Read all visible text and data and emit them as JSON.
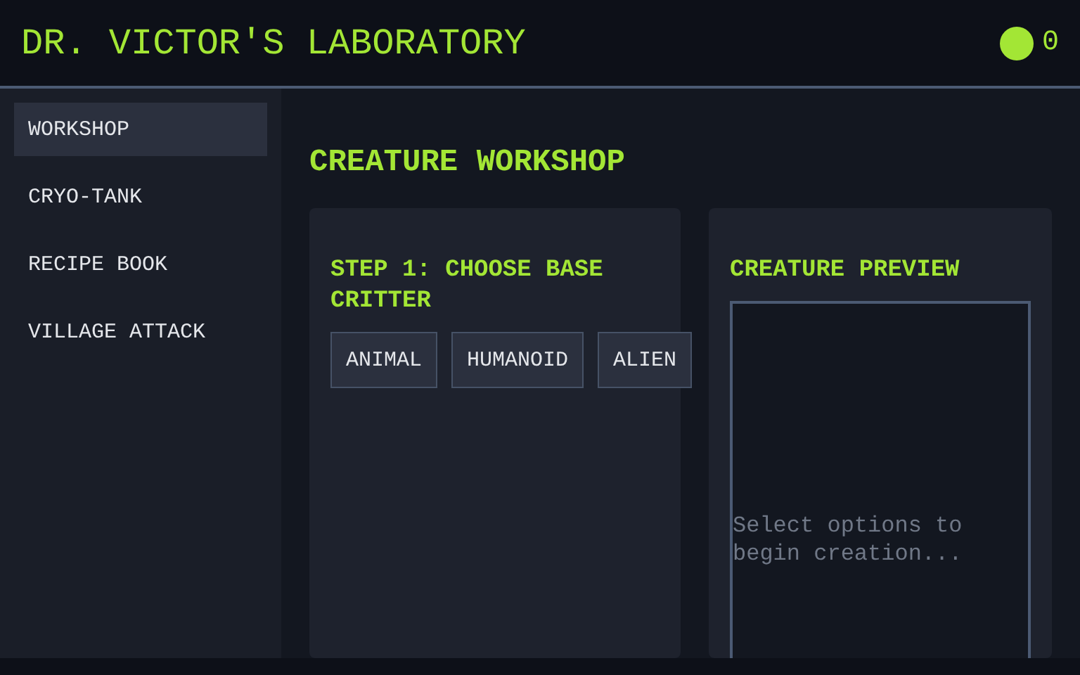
{
  "header": {
    "title": "DR. VICTOR'S LABORATORY",
    "status_count": "0"
  },
  "sidebar": {
    "items": [
      {
        "label": "WORKSHOP",
        "selected": true
      },
      {
        "label": "CRYO-TANK",
        "selected": false
      },
      {
        "label": "RECIPE BOOK",
        "selected": false
      },
      {
        "label": "VILLAGE ATTACK",
        "selected": false
      }
    ]
  },
  "main": {
    "title": "CREATURE WORKSHOP",
    "step_card": {
      "heading": "STEP 1: CHOOSE BASE CRITTER",
      "options": [
        {
          "label": "ANIMAL",
          "selected": false
        },
        {
          "label": "HUMANOID",
          "selected": false
        },
        {
          "label": "ALIEN",
          "selected": false
        }
      ]
    },
    "preview_card": {
      "heading": "CREATURE PREVIEW",
      "placeholder_text": "Select options to begin creation..."
    }
  }
}
